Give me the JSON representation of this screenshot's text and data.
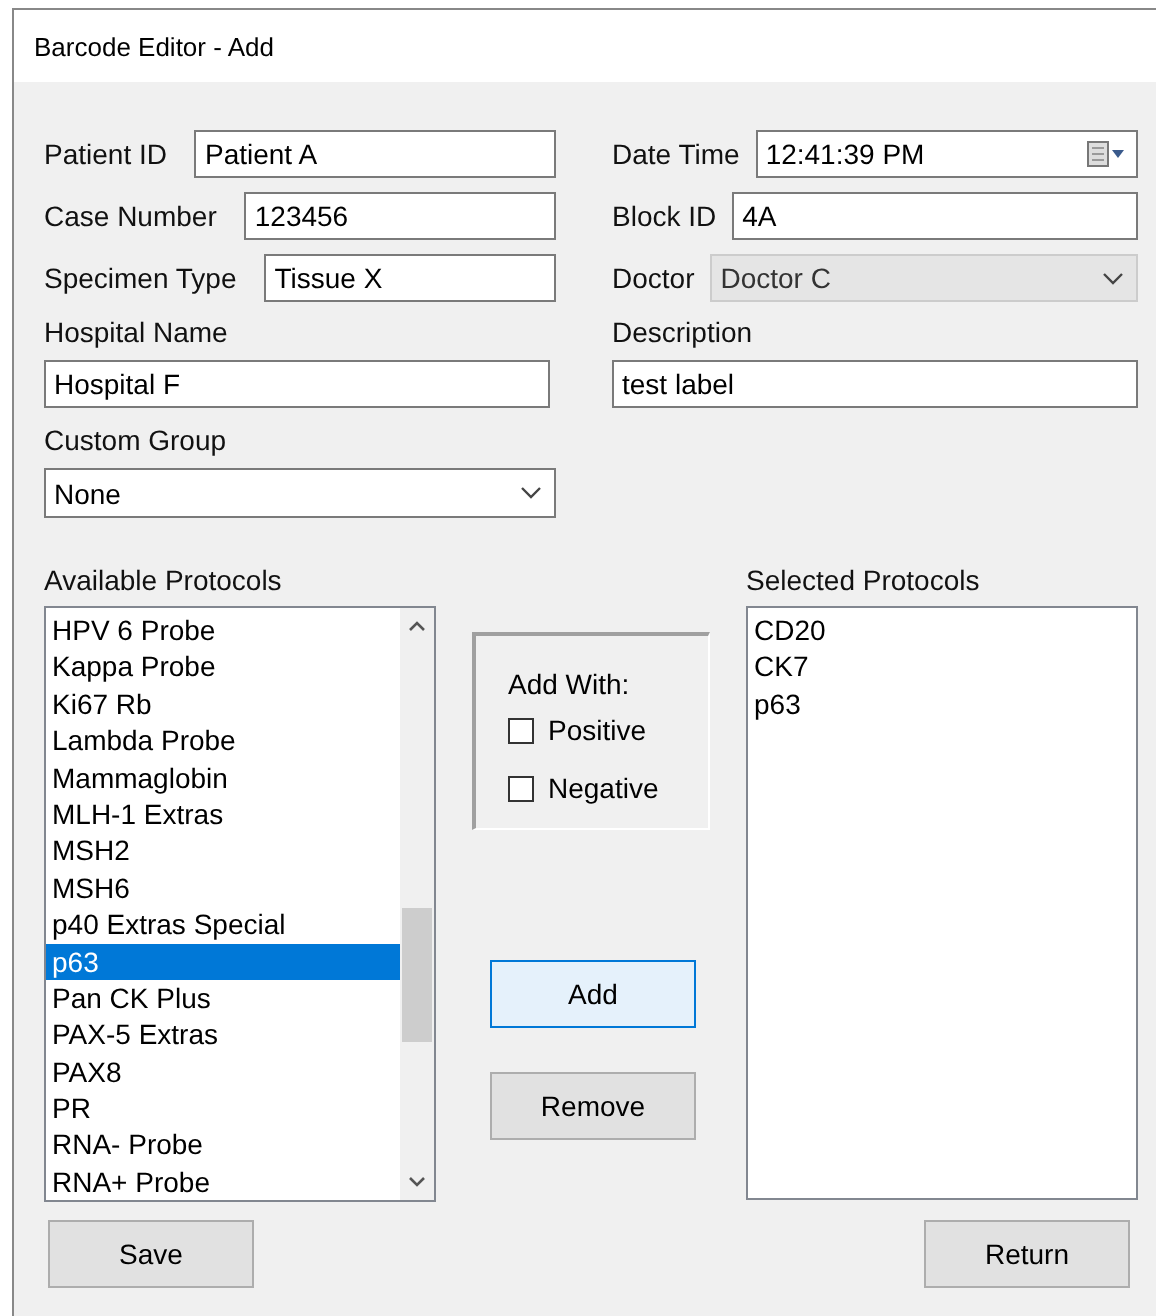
{
  "window": {
    "title": "Barcode Editor - Add"
  },
  "left_fields": [
    {
      "kind": "text",
      "label": "Patient ID",
      "value": "Patient A"
    },
    {
      "kind": "text",
      "label": "Case Number",
      "value": "123456"
    },
    {
      "kind": "text",
      "label": "Specimen Type",
      "value": "Tissue X"
    }
  ],
  "right_fields": [
    {
      "kind": "datetime",
      "label": "Date Time",
      "value": "12:41:39 PM",
      "disabled": false
    },
    {
      "kind": "text",
      "label": "Block ID",
      "value": "4A",
      "disabled": false
    },
    {
      "kind": "combo",
      "label": "Doctor",
      "value": "Doctor C",
      "disabled": true
    }
  ],
  "hospital_name": {
    "label": "Hospital Name",
    "value": "Hospital F"
  },
  "description": {
    "label": "Description",
    "value": "test label"
  },
  "custom_group": {
    "label": "Custom Group",
    "value": "None"
  },
  "available_protocols": {
    "label": "Available Protocols",
    "items": [
      {
        "text": "HPV 6 Probe",
        "selected": false
      },
      {
        "text": "Kappa Probe",
        "selected": false
      },
      {
        "text": "Ki67 Rb",
        "selected": false
      },
      {
        "text": "Lambda Probe",
        "selected": false
      },
      {
        "text": "Mammaglobin",
        "selected": false
      },
      {
        "text": "MLH-1 Extras",
        "selected": false
      },
      {
        "text": "MSH2",
        "selected": false
      },
      {
        "text": "MSH6",
        "selected": false
      },
      {
        "text": "p40 Extras Special",
        "selected": false
      },
      {
        "text": "p63",
        "selected": true
      },
      {
        "text": "Pan CK Plus",
        "selected": false
      },
      {
        "text": "PAX-5 Extras",
        "selected": false
      },
      {
        "text": "PAX8",
        "selected": false
      },
      {
        "text": "PR",
        "selected": false
      },
      {
        "text": "RNA- Probe",
        "selected": false
      },
      {
        "text": "RNA+ Probe",
        "selected": false
      }
    ]
  },
  "add_with": {
    "label": "Add With:",
    "options": [
      {
        "label": "Positive",
        "checked": false
      },
      {
        "label": "Negative",
        "checked": false
      }
    ]
  },
  "middle_buttons": [
    {
      "label": "Add",
      "focused": true
    },
    {
      "label": "Remove",
      "focused": false
    }
  ],
  "selected_protocols": {
    "label": "Selected Protocols",
    "items": [
      {
        "text": "CD20",
        "selected": false
      },
      {
        "text": "CK7",
        "selected": false
      },
      {
        "text": "p63",
        "selected": false
      }
    ]
  },
  "bottom_buttons": [
    {
      "label": "Save"
    },
    {
      "label": "Return"
    }
  ]
}
